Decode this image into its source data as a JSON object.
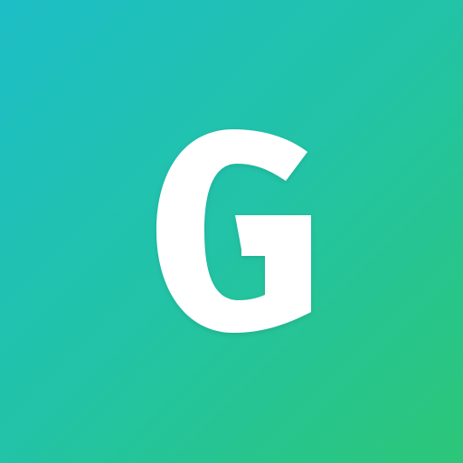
{
  "logo": {
    "letter": "G",
    "letter_color": "#ffffff",
    "background_gradient": [
      "#1dbec6",
      "#22c3a6",
      "#2cc678"
    ]
  }
}
